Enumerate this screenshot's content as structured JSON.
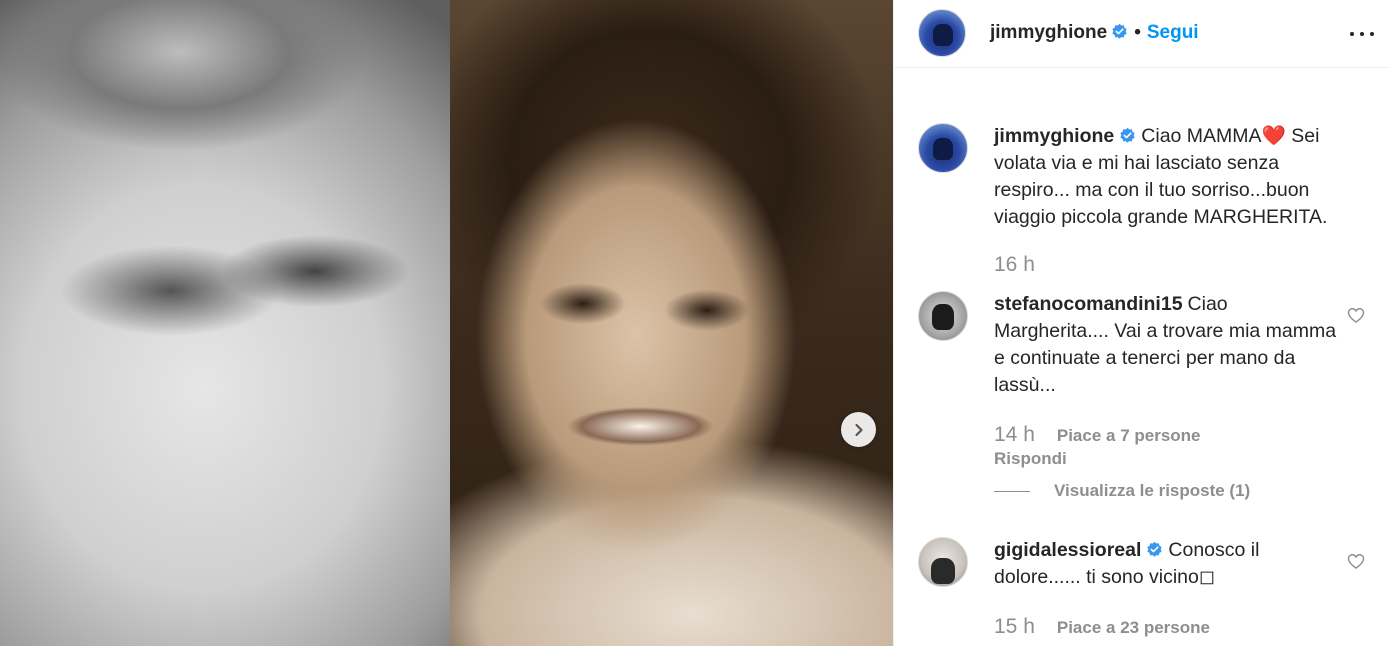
{
  "post": {
    "author": "jimmyghione",
    "follow_label": "Segui",
    "separator": "•"
  },
  "caption": {
    "username": "jimmyghione",
    "text_before": "Ciao MAMMA",
    "emoji": "❤️",
    "text_after": " Sei volata via e mi hai lasciato senza respiro... ma con il tuo sorriso...buon viaggio piccola grande MARGHERITA.",
    "time": "16 h"
  },
  "comments": [
    {
      "username": "stefanocomandini15",
      "text": "Ciao Margherita.... Vai a trovare mia mamma e continuate a tenerci per mano da lassù...",
      "time": "14 h",
      "likes": "Piace a 7 persone",
      "reply_label": "Rispondi",
      "view_replies": "Visualizza le risposte (1)"
    },
    {
      "username": "gigidalessioreal",
      "text": "Conosco il dolore...... ti sono vicino◻",
      "time": "15 h",
      "likes": "Piace a 23 persone"
    }
  ],
  "icons": {
    "verified": "verified-badge-icon",
    "more": "more-options-icon",
    "heart": "heart-outline-icon",
    "next": "chevron-right-icon"
  },
  "colors": {
    "link": "#0095f6",
    "verified": "#3897f0",
    "secondary_text": "#8e8e8e"
  }
}
